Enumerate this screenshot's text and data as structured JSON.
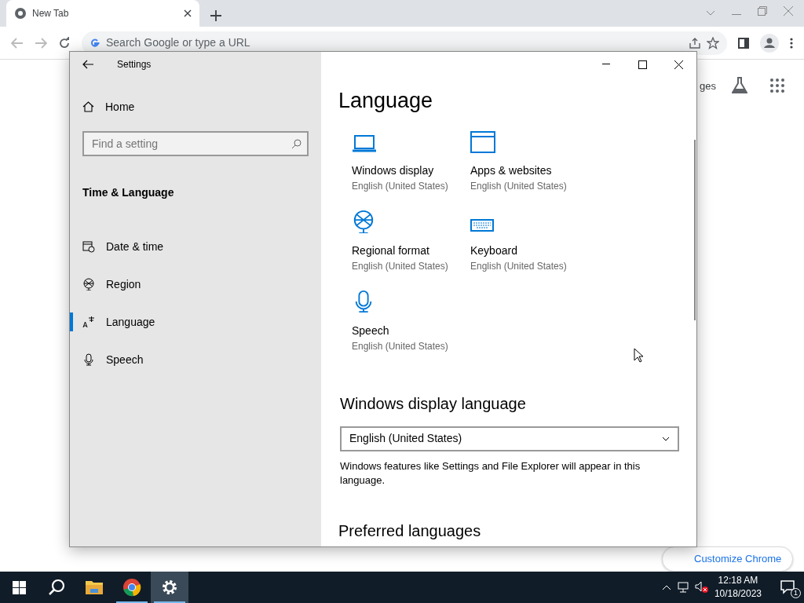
{
  "browser": {
    "tab": {
      "title": "New Tab"
    },
    "address_bar": {
      "placeholder": "Search Google or type a URL"
    },
    "page": {
      "link_partial": "ges",
      "customize_button": "Customize Chrome"
    }
  },
  "settings": {
    "title": "Settings",
    "home": "Home",
    "search": {
      "placeholder": "Find a setting"
    },
    "section": "Time & Language",
    "nav": [
      {
        "label": "Date & time",
        "kind": "clock",
        "selected": false
      },
      {
        "label": "Region",
        "kind": "globe",
        "selected": false
      },
      {
        "label": "Language",
        "kind": "lang",
        "selected": true
      },
      {
        "label": "Speech",
        "kind": "mic",
        "selected": false
      }
    ],
    "heading": "Language",
    "tiles": [
      {
        "label": "Windows display",
        "value": "English (United States)",
        "kind": "laptop"
      },
      {
        "label": "Apps & websites",
        "value": "English (United States)",
        "kind": "window"
      },
      {
        "label": "Regional format",
        "value": "English (United States)",
        "kind": "globe"
      },
      {
        "label": "Keyboard",
        "value": "English (United States)",
        "kind": "keyboard"
      },
      {
        "label": "Speech",
        "value": "English (United States)",
        "kind": "mic"
      }
    ],
    "display_language": {
      "heading": "Windows display language",
      "value": "English (United States)",
      "description": "Windows features like Settings and File Explorer will appear in this language."
    },
    "preferred_heading": "Preferred languages"
  },
  "taskbar": {
    "apps": [
      {
        "kind": "search",
        "running": false,
        "selected": false
      },
      {
        "kind": "folder",
        "running": false,
        "selected": false
      },
      {
        "kind": "chrome",
        "running": true,
        "selected": false
      },
      {
        "kind": "gear",
        "running": true,
        "selected": true
      }
    ],
    "time": "12:18 AM",
    "date": "10/18/2023",
    "notifications": "1"
  }
}
